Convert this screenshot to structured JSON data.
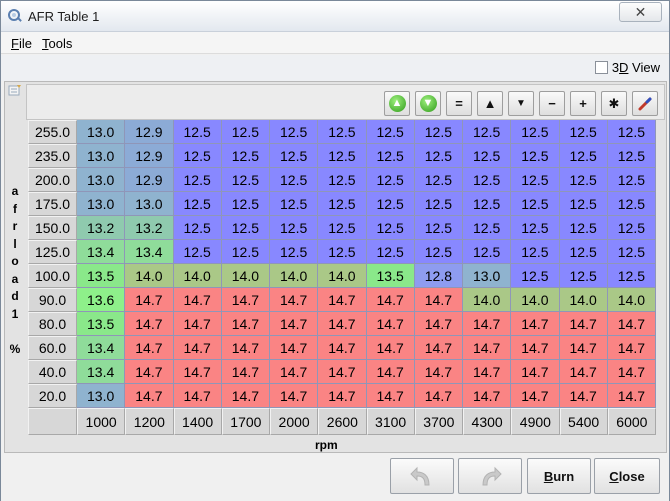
{
  "window": {
    "title": "AFR Table 1",
    "close_glyph": "✕"
  },
  "menu": {
    "file": "File",
    "file_mnemonic": "F",
    "file_rest": "ile",
    "tools_mnemonic": "T",
    "tools_rest": "ools"
  },
  "options": {
    "view3d_pre": "3",
    "view3d_mn": "D",
    "view3d_post": " View"
  },
  "toolbar": {
    "buttons": [
      "inc-icon",
      "dec-icon",
      "=",
      "▲",
      "▼",
      "−",
      "+",
      "✱",
      "pencil-icon"
    ]
  },
  "yaxis": {
    "label": "afrload1 %"
  },
  "xaxis": {
    "label": "rpm"
  },
  "table": {
    "row_headers": [
      "255.0",
      "235.0",
      "200.0",
      "175.0",
      "150.0",
      "125.0",
      "100.0",
      "90.0",
      "80.0",
      "60.0",
      "40.0",
      "20.0"
    ],
    "col_headers": [
      "1000",
      "1200",
      "1400",
      "1700",
      "2000",
      "2600",
      "3100",
      "3700",
      "4300",
      "4900",
      "5400",
      "6000"
    ],
    "rows": [
      [
        "13.0",
        "12.9",
        "12.5",
        "12.5",
        "12.5",
        "12.5",
        "12.5",
        "12.5",
        "12.5",
        "12.5",
        "12.5",
        "12.5"
      ],
      [
        "13.0",
        "12.9",
        "12.5",
        "12.5",
        "12.5",
        "12.5",
        "12.5",
        "12.5",
        "12.5",
        "12.5",
        "12.5",
        "12.5"
      ],
      [
        "13.0",
        "12.9",
        "12.5",
        "12.5",
        "12.5",
        "12.5",
        "12.5",
        "12.5",
        "12.5",
        "12.5",
        "12.5",
        "12.5"
      ],
      [
        "13.0",
        "13.0",
        "12.5",
        "12.5",
        "12.5",
        "12.5",
        "12.5",
        "12.5",
        "12.5",
        "12.5",
        "12.5",
        "12.5"
      ],
      [
        "13.2",
        "13.2",
        "12.5",
        "12.5",
        "12.5",
        "12.5",
        "12.5",
        "12.5",
        "12.5",
        "12.5",
        "12.5",
        "12.5"
      ],
      [
        "13.4",
        "13.4",
        "12.5",
        "12.5",
        "12.5",
        "12.5",
        "12.5",
        "12.5",
        "12.5",
        "12.5",
        "12.5",
        "12.5"
      ],
      [
        "13.5",
        "14.0",
        "14.0",
        "14.0",
        "14.0",
        "14.0",
        "13.5",
        "12.8",
        "13.0",
        "12.5",
        "12.5",
        "12.5"
      ],
      [
        "13.6",
        "14.7",
        "14.7",
        "14.7",
        "14.7",
        "14.7",
        "14.7",
        "14.7",
        "14.0",
        "14.0",
        "14.0",
        "14.0"
      ],
      [
        "13.5",
        "14.7",
        "14.7",
        "14.7",
        "14.7",
        "14.7",
        "14.7",
        "14.7",
        "14.7",
        "14.7",
        "14.7",
        "14.7"
      ],
      [
        "13.4",
        "14.7",
        "14.7",
        "14.7",
        "14.7",
        "14.7",
        "14.7",
        "14.7",
        "14.7",
        "14.7",
        "14.7",
        "14.7"
      ],
      [
        "13.4",
        "14.7",
        "14.7",
        "14.7",
        "14.7",
        "14.7",
        "14.7",
        "14.7",
        "14.7",
        "14.7",
        "14.7",
        "14.7"
      ],
      [
        "13.0",
        "14.7",
        "14.7",
        "14.7",
        "14.7",
        "14.7",
        "14.7",
        "14.7",
        "14.7",
        "14.7",
        "14.7",
        "14.7"
      ]
    ],
    "colors": {
      "12.5": "#8888ff",
      "12.8": "#8e9cf0",
      "12.9": "#8cabd6",
      "13.0": "#8fb3cf",
      "13.2": "#8fcaae",
      "13.4": "#8fdc9a",
      "13.5": "#8ae88a",
      "13.6": "#8ef08a",
      "14.0": "#aac887",
      "14.7": "#fa8484"
    }
  },
  "buttons": {
    "burn_mn": "B",
    "burn_rest": "urn",
    "close_mn": "C",
    "close_rest": "lose"
  }
}
